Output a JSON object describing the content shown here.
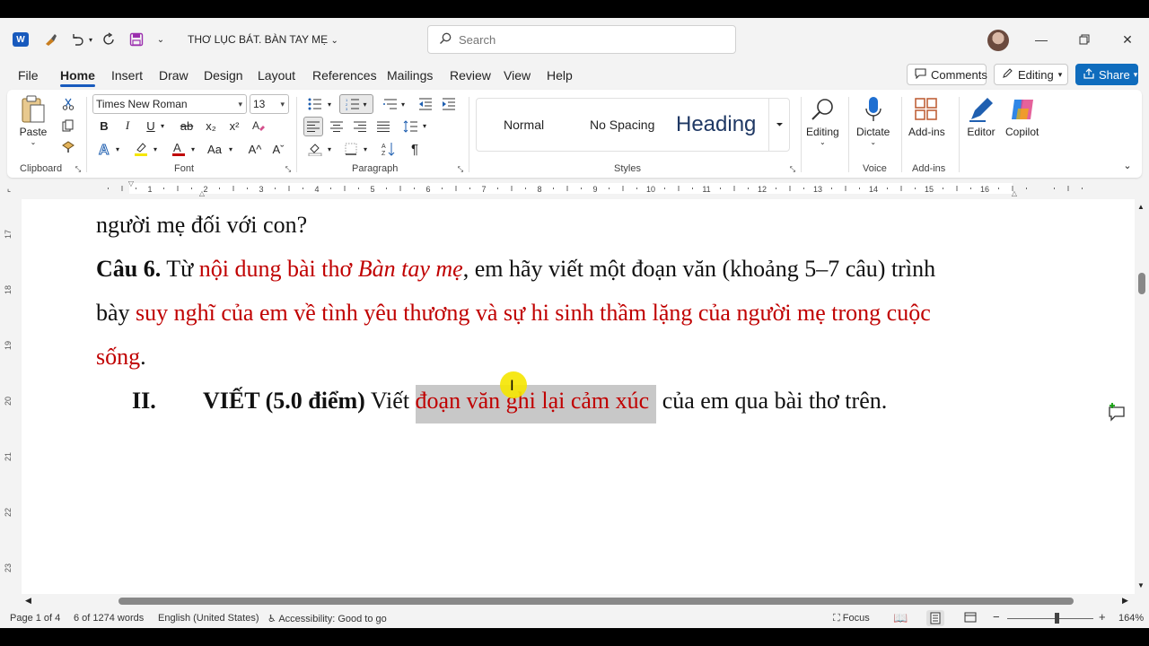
{
  "app": {
    "logo_letter": "W"
  },
  "title": {
    "doc_name": "THƠ LỤC BÁT. BÀN TAY MẸ"
  },
  "search": {
    "placeholder": "Search"
  },
  "menu": {
    "tabs": [
      "File",
      "Home",
      "Insert",
      "Draw",
      "Design",
      "Layout",
      "References",
      "Mailings",
      "Review",
      "View",
      "Help"
    ],
    "active": "Home",
    "comments": "Comments",
    "editing": "Editing",
    "share": "Share"
  },
  "ribbon": {
    "clipboard": {
      "paste": "Paste",
      "label": "Clipboard"
    },
    "font": {
      "name": "Times New Roman",
      "size": "13",
      "label": "Font",
      "bold": "B",
      "italic": "I",
      "underline": "U",
      "strike": "ab",
      "sub": "x₂",
      "sup": "x²",
      "case": "Aa",
      "grow": "A^",
      "shrink": "Aˇ"
    },
    "paragraph": {
      "label": "Paragraph",
      "pilcrow": "¶"
    },
    "styles": {
      "label": "Styles",
      "items": [
        "Normal",
        "No Spacing",
        "Heading"
      ]
    },
    "editing": {
      "label": "Editing"
    },
    "voice": {
      "dictate": "Dictate",
      "label": "Voice"
    },
    "addins": {
      "addins": "Add-ins",
      "label": "Add-ins"
    },
    "editor": "Editor",
    "copilot": "Copilot"
  },
  "ruler": {
    "ticks": [
      "1",
      "2",
      "3",
      "4",
      "5",
      "6",
      "7",
      "8",
      "9",
      "10",
      "11",
      "12",
      "13",
      "14",
      "15",
      "16"
    ]
  },
  "vruler": {
    "ticks": [
      "17",
      "18",
      "19",
      "20",
      "21",
      "22",
      "23"
    ]
  },
  "document": {
    "line1": "người mẹ đối với con?",
    "cau6_label": "Câu 6.",
    "cau6_a": " Từ ",
    "cau6_b": "nội dung bài thơ ",
    "cau6_c": "Bàn tay mẹ",
    "cau6_d": ", em hãy viết một đoạn văn (khoảng 5–7 câu) trình",
    "line3_a": "bày ",
    "line3_b": "suy nghĩ của em về tình yêu thương và sự hi sinh thầm lặng của người mẹ trong cuộc",
    "line4_a": "sống",
    "line4_b": ".",
    "sec_num": "II.",
    "sec_title": "VIẾT (5.0 điểm)",
    "sec_a": " Viết ",
    "sec_hl": "đoạn văn ghi lại cảm xúc",
    "sec_b": " của em qua bài thơ trên."
  },
  "status": {
    "page": "Page 1 of 4",
    "words": "6 of 1274 words",
    "language": "English (United States)",
    "accessibility": "Accessibility: Good to go",
    "focus": "Focus",
    "zoom": "164%"
  },
  "colors": {
    "accent": "#185abd",
    "red_text": "#c00000",
    "highlight": "#c8c8c8",
    "cursor_dot": "#f5e600"
  }
}
